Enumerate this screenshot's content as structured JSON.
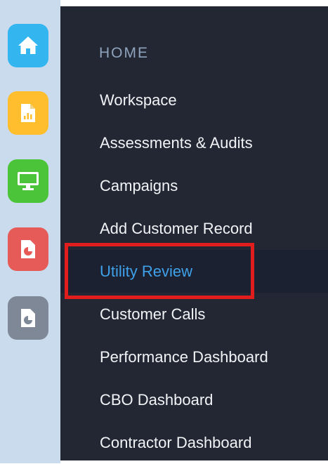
{
  "colors": {
    "rail_bg": "#c9dbec",
    "menu_bg": "#222733",
    "active_bg": "#1b2130",
    "active_text": "#3fa1ea",
    "annotation_red": "#e11d1d"
  },
  "rail": {
    "buttons": [
      {
        "icon": "home-icon",
        "color": "#33b5f0"
      },
      {
        "icon": "report-chart-icon",
        "color": "#ffbe2d"
      },
      {
        "icon": "monitor-icon",
        "color": "#4cc43a"
      },
      {
        "icon": "pie-document-icon",
        "color": "#e65b57"
      },
      {
        "icon": "pie-document-icon",
        "color": "#7f8897"
      }
    ]
  },
  "menu": {
    "section_title": "HOME",
    "items": [
      {
        "label": "Workspace"
      },
      {
        "label": "Assessments & Audits"
      },
      {
        "label": "Campaigns"
      },
      {
        "label": "Add Customer Record"
      },
      {
        "label": "Utility Review",
        "active": true
      },
      {
        "label": "Customer Calls"
      },
      {
        "label": "Performance Dashboard"
      },
      {
        "label": "CBO Dashboard"
      },
      {
        "label": "Contractor Dashboard"
      }
    ]
  }
}
